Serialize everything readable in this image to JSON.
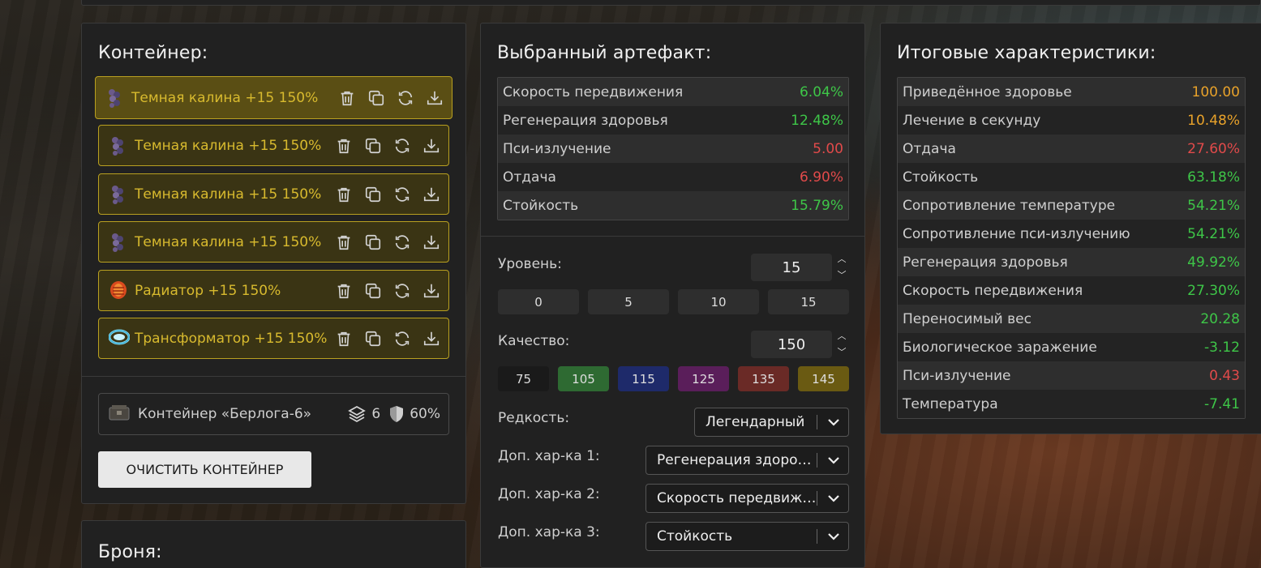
{
  "container": {
    "title": "Контейнер:",
    "items": [
      {
        "label": "Темная калина +15 150%",
        "icon": "dark-kalina-icon",
        "selected": true
      },
      {
        "label": "Темная калина +15 150%",
        "icon": "dark-kalina-icon"
      },
      {
        "label": "Темная калина +15 150%",
        "icon": "dark-kalina-icon"
      },
      {
        "label": "Темная калина +15 150%",
        "icon": "dark-kalina-icon"
      },
      {
        "label": "Радиатор +15 150%",
        "icon": "radiator-icon"
      },
      {
        "label": "Трансформатор +15 150%",
        "icon": "transformer-icon"
      }
    ],
    "box": {
      "label": "Контейнер «Берлога-6»",
      "slots": "6",
      "protection": "60%"
    },
    "clear_button": "ОЧИСТИТЬ КОНТЕЙНЕР"
  },
  "armor": {
    "title": "Броня:"
  },
  "artifact": {
    "title": "Выбранный артефакт:",
    "stats": [
      {
        "name": "Скорость передвижения",
        "value": "6.04%",
        "color": "green"
      },
      {
        "name": "Регенерация здоровья",
        "value": "12.48%",
        "color": "green"
      },
      {
        "name": "Пси-излучение",
        "value": "5.00",
        "color": "red"
      },
      {
        "name": "Отдача",
        "value": "6.90%",
        "color": "red"
      },
      {
        "name": "Стойкость",
        "value": "15.79%",
        "color": "green"
      }
    ],
    "level": {
      "label": "Уровень:",
      "value": "15",
      "presets": [
        "0",
        "5",
        "10",
        "15"
      ]
    },
    "quality": {
      "label": "Качество:",
      "value": "150",
      "presets": [
        {
          "label": "75",
          "bg": "#1a1a1a"
        },
        {
          "label": "105",
          "bg": "#2e6a32"
        },
        {
          "label": "115",
          "bg": "#1e2a6a"
        },
        {
          "label": "125",
          "bg": "#5a1e5a"
        },
        {
          "label": "135",
          "bg": "#6a2a26"
        },
        {
          "label": "145",
          "bg": "#6a5a12"
        }
      ]
    },
    "rarity": {
      "label": "Редкость:",
      "value": "Легендарный"
    },
    "extra1": {
      "label": "Доп. хар-ка 1:",
      "value": "Регенерация здоровья"
    },
    "extra2": {
      "label": "Доп. хар-ка 2:",
      "value": "Скорость передвижения"
    },
    "extra3": {
      "label": "Доп. хар-ка 3:",
      "value": "Стойкость"
    }
  },
  "totals": {
    "title": "Итоговые характеристики:",
    "stats": [
      {
        "name": "Приведённое здоровье",
        "value": "100.00",
        "color": "orange"
      },
      {
        "name": "Лечение в секунду",
        "value": "10.48%",
        "color": "orange"
      },
      {
        "name": "Отдача",
        "value": "27.60%",
        "color": "red"
      },
      {
        "name": "Стойкость",
        "value": "63.18%",
        "color": "green"
      },
      {
        "name": "Сопротивление температуре",
        "value": "54.21%",
        "color": "green"
      },
      {
        "name": "Сопротивление пси-излучению",
        "value": "54.21%",
        "color": "green"
      },
      {
        "name": "Регенерация здоровья",
        "value": "49.92%",
        "color": "green"
      },
      {
        "name": "Скорость передвижения",
        "value": "27.30%",
        "color": "green"
      },
      {
        "name": "Переносимый вес",
        "value": "20.28",
        "color": "green"
      },
      {
        "name": "Биологическое заражение",
        "value": "-3.12",
        "color": "green"
      },
      {
        "name": "Пси-излучение",
        "value": "0.43",
        "color": "red"
      },
      {
        "name": "Температура",
        "value": "-7.41",
        "color": "green"
      }
    ]
  },
  "colors": {
    "accent_gold": "#d8ba2e",
    "green": "#3ec648",
    "red": "#e14a4a",
    "orange": "#e8a22a"
  }
}
